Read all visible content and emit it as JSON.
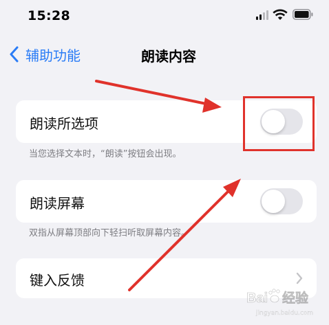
{
  "status_bar": {
    "time": "15:28",
    "signal_icon": "cellular-signal-icon",
    "wifi_icon": "wifi-icon",
    "battery_icon": "battery-icon"
  },
  "nav": {
    "back_label": "辅助功能",
    "title": "朗读内容"
  },
  "settings": {
    "speak_selection": {
      "label": "朗读所选项",
      "enabled": false,
      "footnote": "当您选择文本时，“朗读”按钮会出现。"
    },
    "speak_screen": {
      "label": "朗读屏幕",
      "enabled": false,
      "footnote": "双指从屏幕顶部向下轻扫听取屏幕内容。"
    },
    "typing_feedback": {
      "label": "键入反馈"
    }
  },
  "annotations": {
    "accent_color": "#e0322b"
  },
  "watermark": {
    "text": "Bai度经验",
    "subtext": "jingyan.baidu.com"
  }
}
